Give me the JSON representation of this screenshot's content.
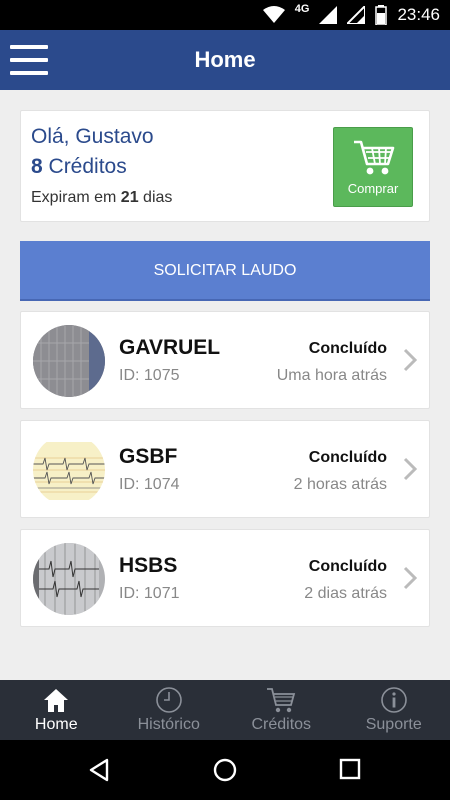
{
  "status_bar": {
    "network": "4G",
    "time": "23:46"
  },
  "app_bar": {
    "title": "Home"
  },
  "greeting": {
    "hello": "Olá, Gustavo",
    "credits_count": "8",
    "credits_label": " Créditos",
    "expire_prefix": "Expiram em ",
    "expire_days": "21",
    "expire_suffix": " dias",
    "buy_label": "Comprar"
  },
  "request_button": {
    "label": "SOLICITAR LAUDO"
  },
  "reports": [
    {
      "name": "GAVRUEL",
      "id": "ID: 1075",
      "status": "Concluído",
      "when": "Uma hora atrás"
    },
    {
      "name": "GSBF",
      "id": "ID: 1074",
      "status": "Concluído",
      "when": "2 horas atrás"
    },
    {
      "name": "HSBS",
      "id": "ID: 1071",
      "status": "Concluído",
      "when": "2 dias atrás"
    }
  ],
  "bottom_nav": [
    {
      "label": "Home",
      "icon": "home-icon",
      "active": true
    },
    {
      "label": "Histórico",
      "icon": "clock-icon",
      "active": false
    },
    {
      "label": "Créditos",
      "icon": "cart-icon",
      "active": false
    },
    {
      "label": "Suporte",
      "icon": "info-icon",
      "active": false
    }
  ],
  "colors": {
    "primary": "#2b4a8c",
    "accent": "#5b7fd0",
    "buy": "#5cb85c",
    "nav_bg": "#2a2f38"
  }
}
